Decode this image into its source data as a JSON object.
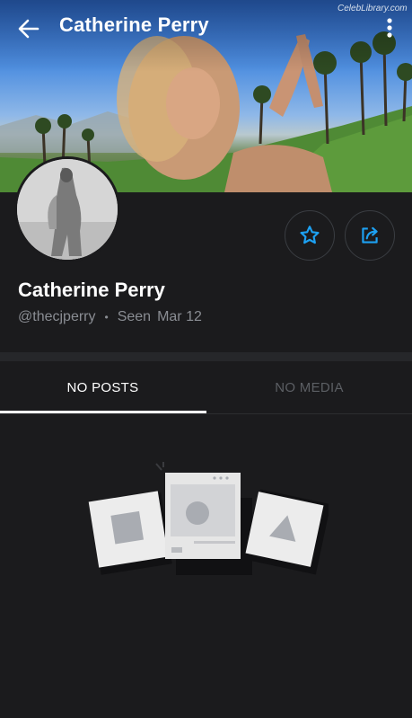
{
  "header": {
    "title": "Catherine Perry",
    "watermark": "CelebLibrary.com"
  },
  "profile": {
    "name": "Catherine Perry",
    "handle": "@thecjperry",
    "separator": "•",
    "seen_label": "Seen",
    "seen_date": "Mar 12"
  },
  "tabs": [
    {
      "label": "NO POSTS",
      "active": true
    },
    {
      "label": "NO MEDIA",
      "active": false
    }
  ],
  "colors": {
    "accent": "#1da1f2",
    "background": "#1b1b1d",
    "muted_text": "#8a8d93"
  },
  "icons": {
    "back": "arrow-left",
    "more": "vertical-dots",
    "favorite": "star-outline",
    "share": "share-arrow"
  }
}
